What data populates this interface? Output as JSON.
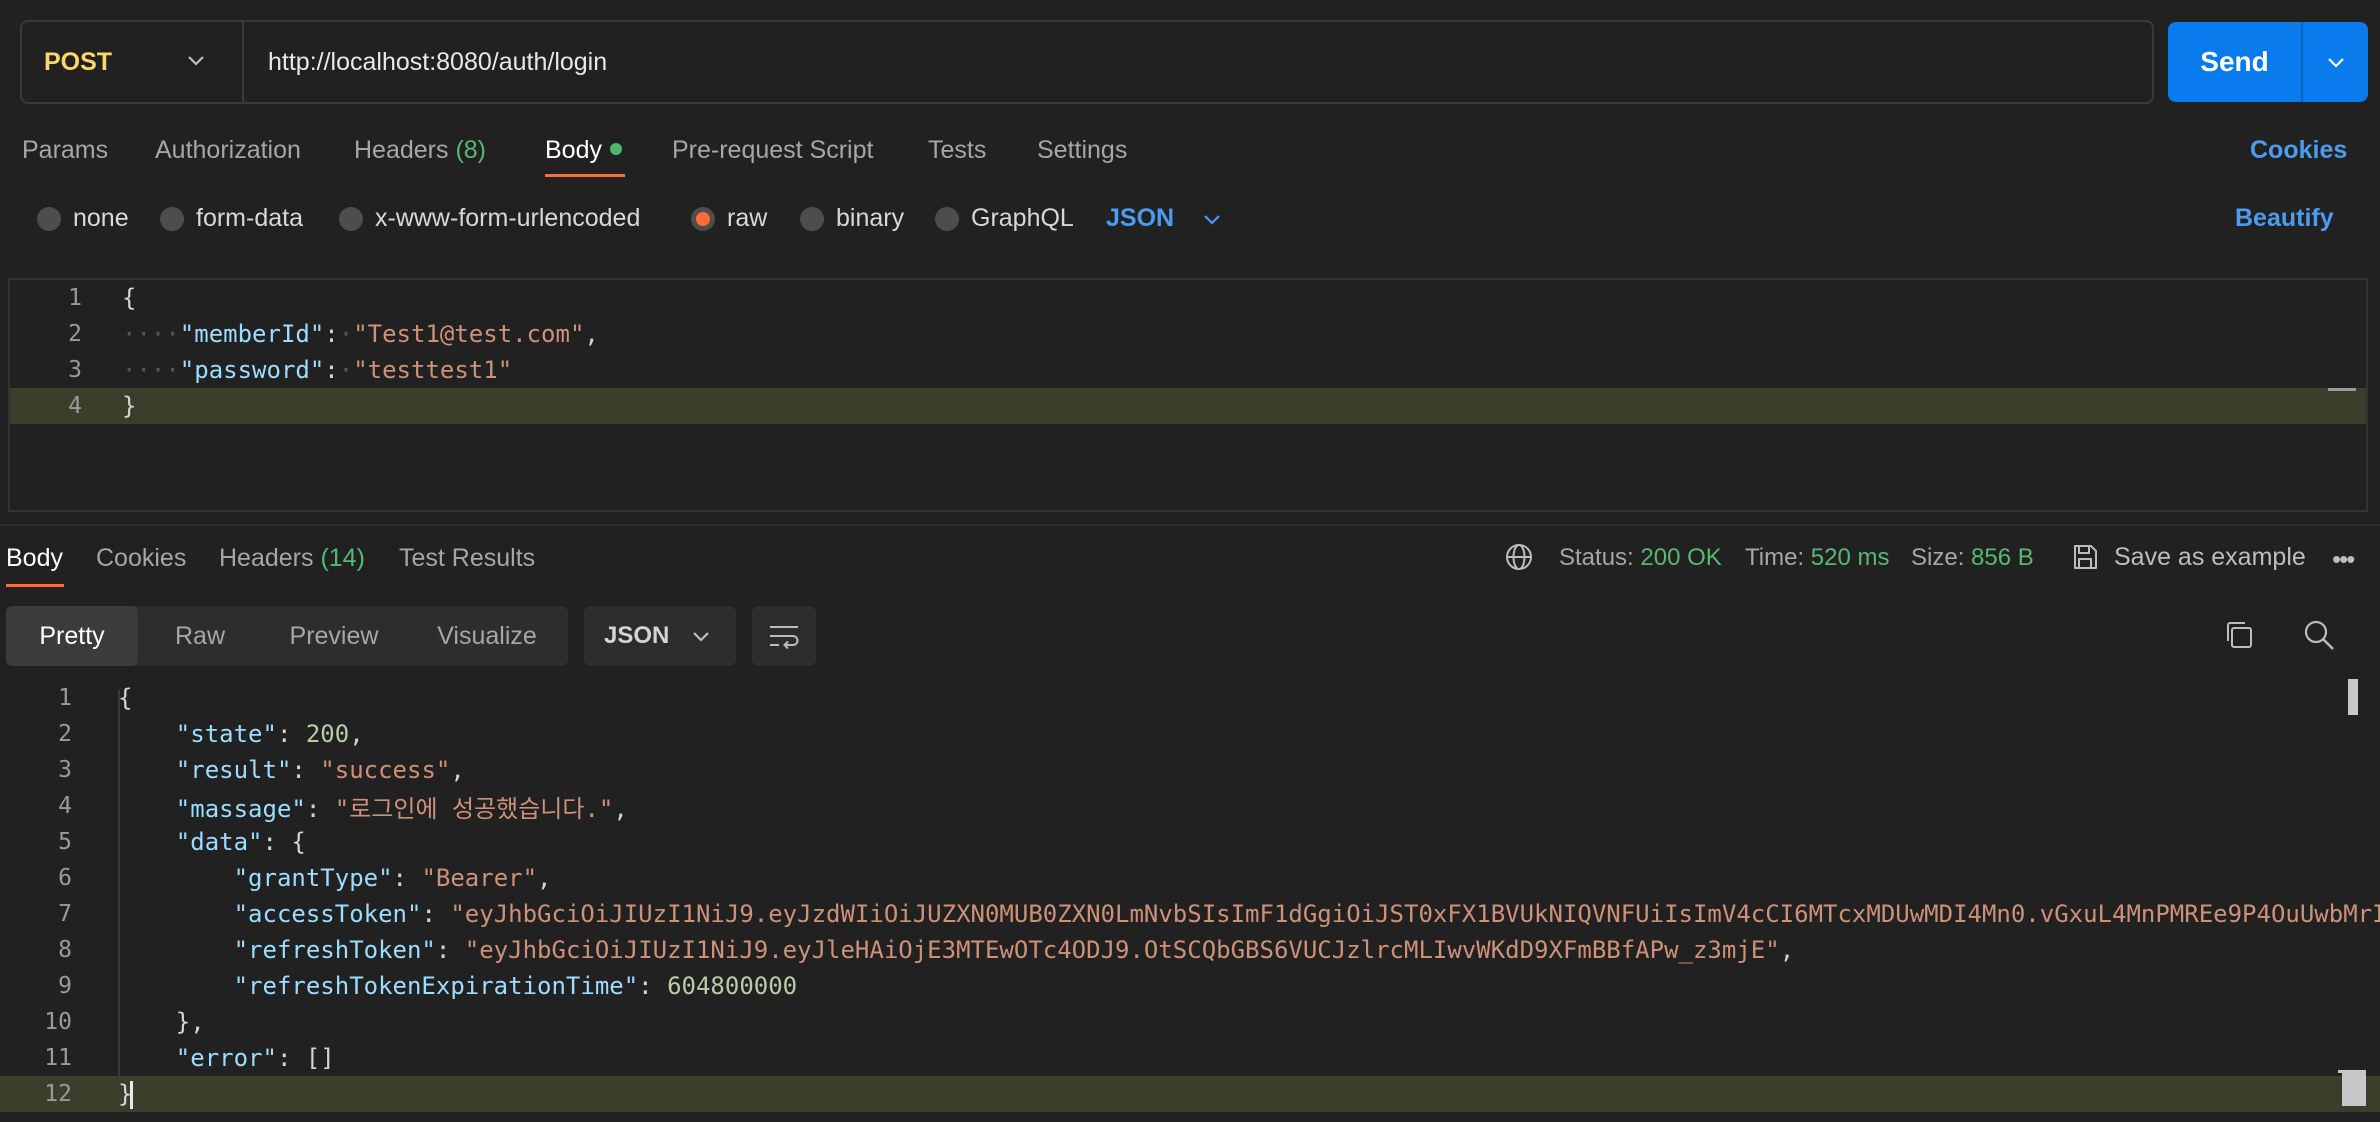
{
  "request": {
    "method": "POST",
    "url": "http://localhost:8080/auth/login",
    "send_label": "Send"
  },
  "request_tabs": {
    "params": "Params",
    "authorization": "Authorization",
    "headers": "Headers",
    "headers_count": "(8)",
    "body": "Body",
    "prerequest": "Pre-request Script",
    "tests": "Tests",
    "settings": "Settings",
    "cookies": "Cookies"
  },
  "body_types": {
    "none": "none",
    "form_data": "form-data",
    "urlencoded": "x-www-form-urlencoded",
    "raw": "raw",
    "binary": "binary",
    "graphql": "GraphQL",
    "format": "JSON",
    "beautify": "Beautify",
    "selected": "raw"
  },
  "request_body": {
    "line_numbers": [
      "1",
      "2",
      "3",
      "4"
    ],
    "member_key": "\"memberId\"",
    "member_value": "\"Test1@test.com\"",
    "password_key": "\"password\"",
    "password_value": "\"testtest1\""
  },
  "response_tabs": {
    "body": "Body",
    "cookies": "Cookies",
    "headers": "Headers",
    "headers_count": "(14)",
    "test_results": "Test Results"
  },
  "response_status": {
    "status_label": "Status:",
    "status_value": "200 OK",
    "time_label": "Time:",
    "time_value": "520 ms",
    "size_label": "Size:",
    "size_value": "856 B",
    "save_example": "Save as example"
  },
  "response_view": {
    "pretty": "Pretty",
    "raw": "Raw",
    "preview": "Preview",
    "visualize": "Visualize",
    "format": "JSON"
  },
  "response_body": {
    "line_numbers": [
      "1",
      "2",
      "3",
      "4",
      "5",
      "6",
      "7",
      "8",
      "9",
      "10",
      "11",
      "12"
    ],
    "state_key": "\"state\"",
    "state_value": "200",
    "result_key": "\"result\"",
    "result_value": "\"success\"",
    "massage_key": "\"massage\"",
    "massage_value": "\"로그인에 성공했습니다.\"",
    "data_key": "\"data\"",
    "grant_key": "\"grantType\"",
    "grant_value": "\"Bearer\"",
    "access_key": "\"accessToken\"",
    "access_value": "\"eyJhbGciOiJIUzI1NiJ9.eyJzdWIiOiJUZXN0MUB0ZXN0LmNvbSIsImF1dGgiOiJST0xFX1BVUkNIQVNFUiIsImV4cCI6MTcxMDUwMDI4Mn0.vGxuL4MnPMREe9P4OuUwbMrI",
    "refresh_key": "\"refreshToken\"",
    "refresh_value": "\"eyJhbGciOiJIUzI1NiJ9.eyJleHAiOjE3MTEwOTc4ODJ9.OtSCQbGBS6VUCJzlrcMLIwvWKdD9XFmBBfAPw_z3mjE\"",
    "expiration_key": "\"refreshTokenExpirationTime\"",
    "expiration_value": "604800000",
    "error_key": "\"error\"",
    "error_value": "[]"
  }
}
